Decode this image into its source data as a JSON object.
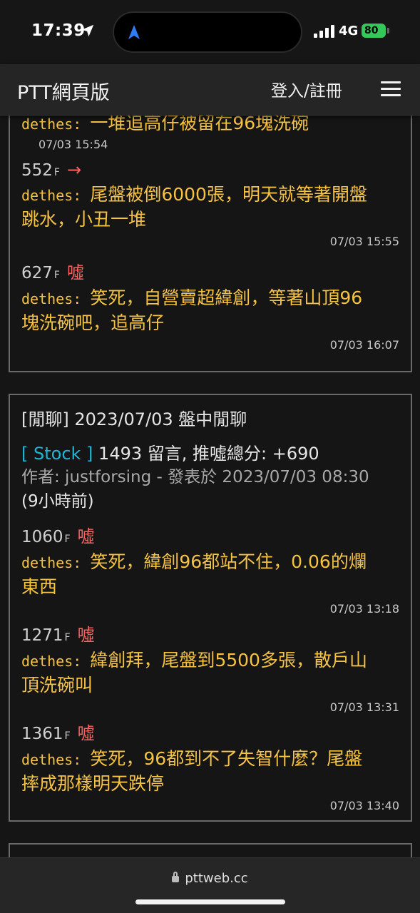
{
  "status": {
    "time": "17:39",
    "network": "4G",
    "battery": "80"
  },
  "header": {
    "brand": "PTT網頁版",
    "login": "登入/註冊"
  },
  "card1": {
    "comments": [
      {
        "floor": "",
        "tag": "",
        "user": "dethes",
        "text_lines": [
          "一堆追高仔被留在96塊洗碗"
        ],
        "time": "07/03 15:54"
      },
      {
        "floor": "552",
        "tag": "→",
        "user": "dethes",
        "text_lines": [
          "尾盤被倒6000張，明天就等著開盤",
          "跳水，小丑一堆"
        ],
        "time": "07/03 15:55"
      },
      {
        "floor": "627",
        "tag": "噓",
        "user": "dethes",
        "text_lines": [
          "笑死，自營賣超緯創，等著山頂96",
          "塊洗碗吧，追高仔"
        ],
        "time": "07/03 16:07"
      }
    ]
  },
  "card2": {
    "title": "[閒聊] 2023/07/03 盤中閒聊",
    "board": "[ Stock ]",
    "meta": "1493 留言, 推噓總分: +690",
    "author": "作者: justforsing - 發表於 2023/07/03 08:30",
    "ago": "(9小時前)",
    "comments": [
      {
        "floor": "1060",
        "tag": "噓",
        "user": "dethes",
        "text_lines": [
          "笑死，緯創96都站不住，0.06的爛",
          "東西"
        ],
        "time": "07/03 13:18"
      },
      {
        "floor": "1271",
        "tag": "噓",
        "user": "dethes",
        "text_lines": [
          "緯創拜，尾盤到5500多張，散戶山",
          "頂洗碗叫"
        ],
        "time": "07/03 13:31"
      },
      {
        "floor": "1361",
        "tag": "噓",
        "user": "dethes",
        "text_lines": [
          "笑死，96都到不了失智什麼？尾盤",
          "摔成那樣明天跌停"
        ],
        "time": "07/03 13:40"
      }
    ]
  },
  "floor_suffix": "F",
  "footer": {
    "url": "pttweb.cc"
  },
  "colors": {
    "push_text": "#f5c242",
    "boo": "#ff5f5f",
    "board": "#1fb6d6",
    "bg": "#151515"
  }
}
